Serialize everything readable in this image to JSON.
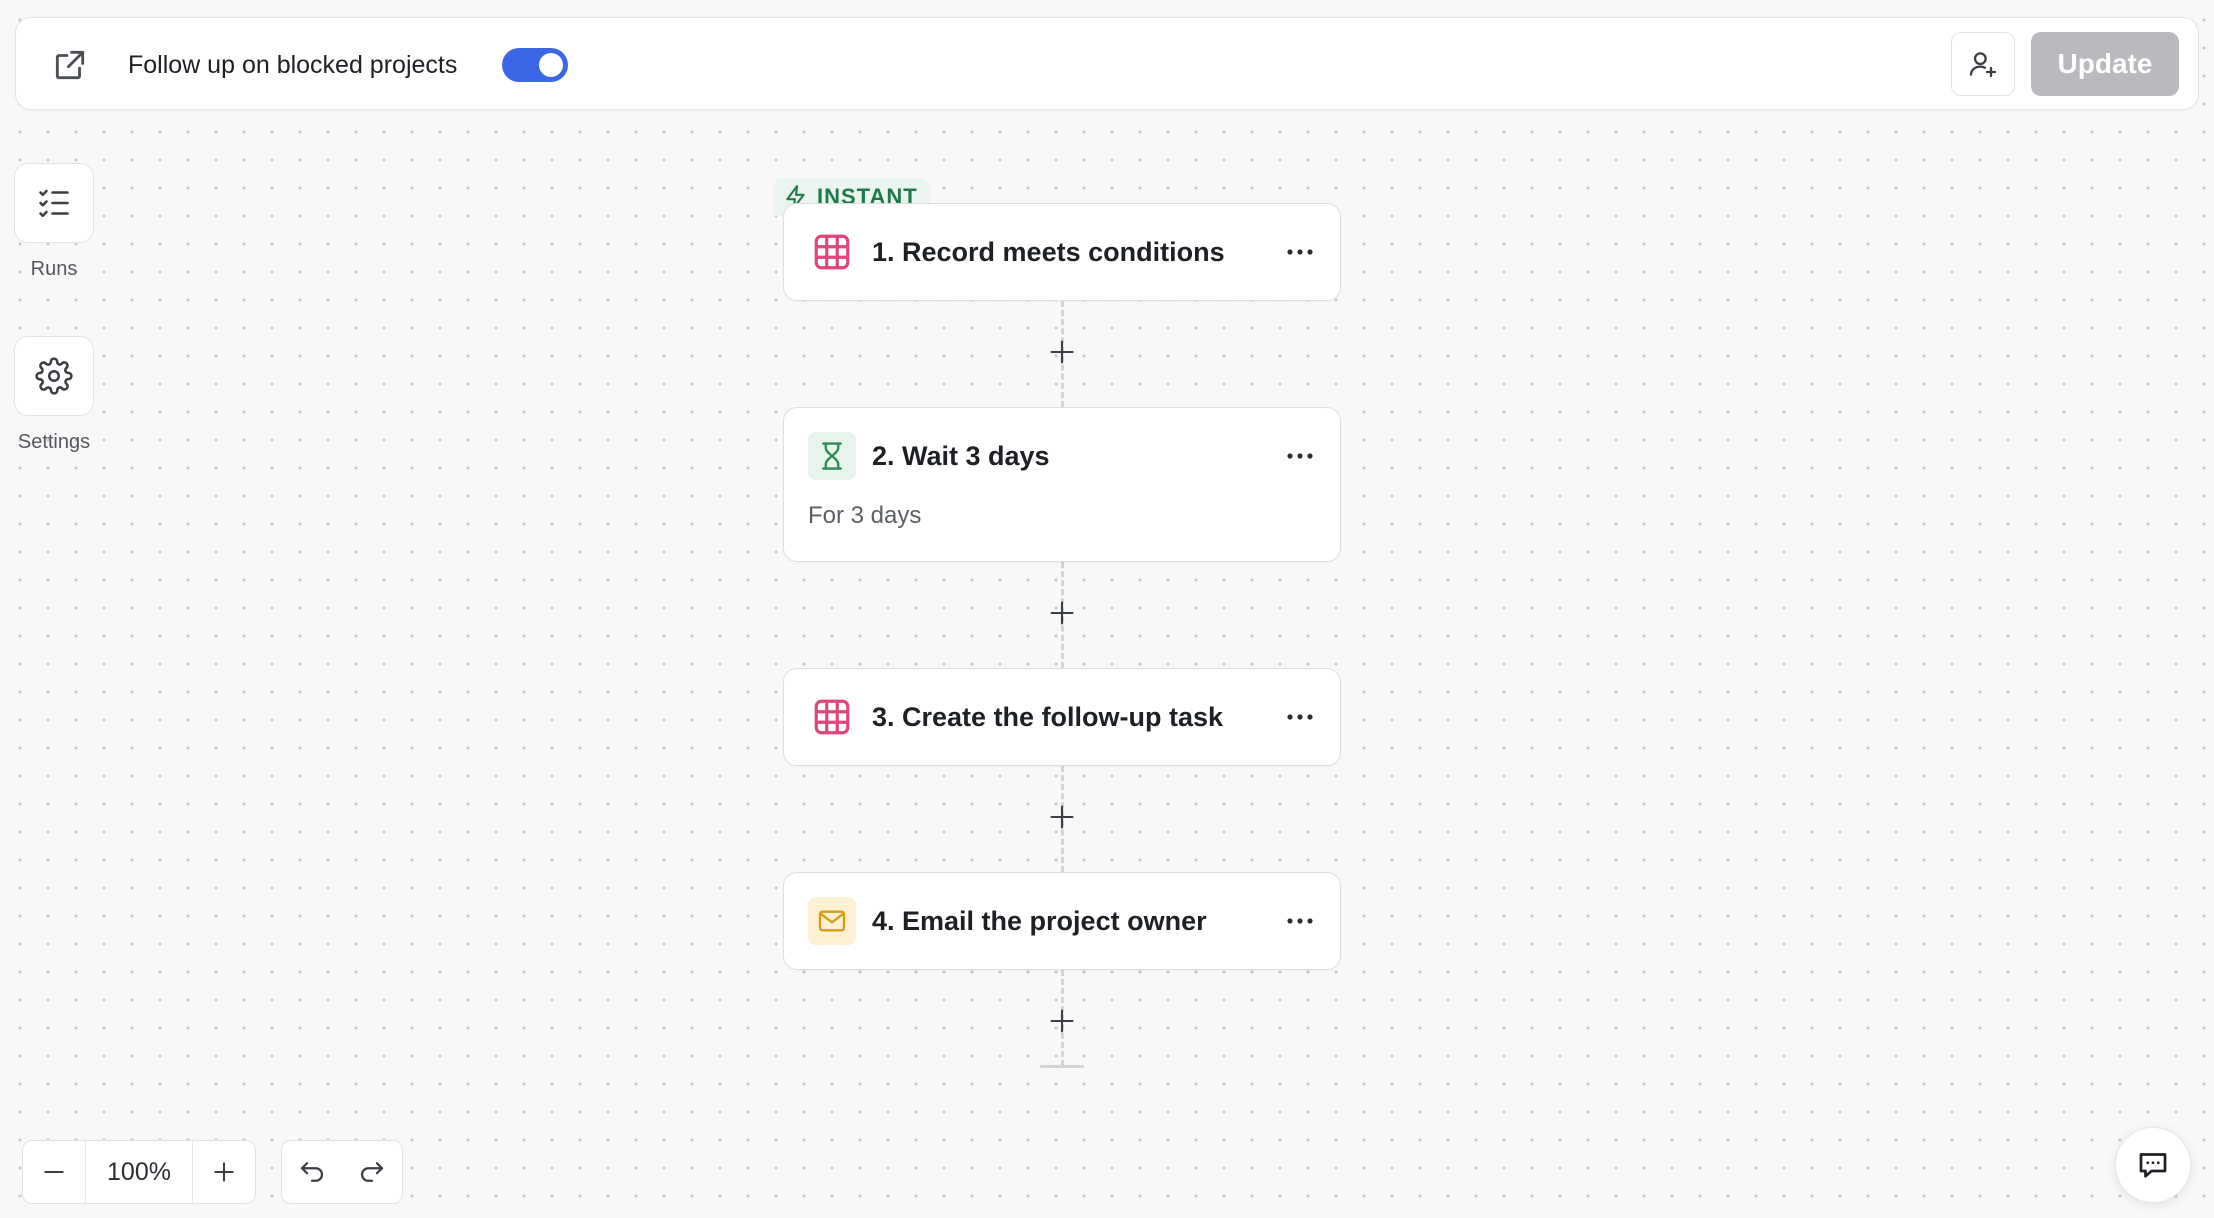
{
  "header": {
    "open_icon": "external-link-icon",
    "title": "Follow up on blocked projects",
    "toggle_on": true,
    "share_icon": "user-plus-icon",
    "update_label": "Update"
  },
  "sidebar": {
    "runs": {
      "icon": "checklist-icon",
      "label": "Runs"
    },
    "settings": {
      "icon": "gear-icon",
      "label": "Settings"
    }
  },
  "flow": {
    "trigger_badge": "INSTANT",
    "steps": [
      {
        "title": "1. Record meets conditions",
        "icon": "table-icon",
        "subtitle": ""
      },
      {
        "title": "2. Wait 3 days",
        "icon": "hourglass-icon",
        "subtitle": "For 3 days"
      },
      {
        "title": "3. Create the follow-up task",
        "icon": "table-icon",
        "subtitle": ""
      },
      {
        "title": "4. Email the project owner",
        "icon": "mail-icon",
        "subtitle": ""
      }
    ]
  },
  "zoom": {
    "value": "100%"
  },
  "colors": {
    "accent": "#3b66e6",
    "table_icon": "#e0457b",
    "hourglass_icon": "#2f8a57",
    "hourglass_bg": "#e7f4ec",
    "mail_icon": "#d99a1a",
    "mail_bg": "#fdf1d3",
    "instant_green": "#1f7a4a",
    "update_disabled": "#b9babd"
  }
}
